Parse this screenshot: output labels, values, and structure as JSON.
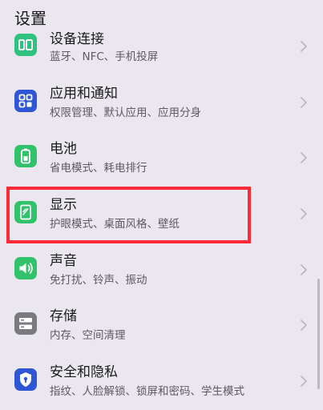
{
  "header": {
    "title": "设置"
  },
  "items": [
    {
      "title": "设备连接",
      "sub": "蓝牙、NFC、手机投屏",
      "icon": "device-connection-icon",
      "color": "#2ec27e"
    },
    {
      "title": "应用和通知",
      "sub": "权限管理、默认应用、应用分身",
      "icon": "apps-icon",
      "color": "#2f56d4"
    },
    {
      "title": "电池",
      "sub": "省电模式、耗电排行",
      "icon": "battery-icon",
      "color": "#33c26c"
    },
    {
      "title": "显示",
      "sub": "护眼模式、桌面风格、壁纸",
      "icon": "display-icon",
      "color": "#33c26c"
    },
    {
      "title": "声音",
      "sub": "免打扰、铃声、振动",
      "icon": "sound-icon",
      "color": "#33c26c"
    },
    {
      "title": "存储",
      "sub": "内存、空间清理",
      "icon": "storage-icon",
      "color": "#7a7a80"
    },
    {
      "title": "安全和隐私",
      "sub": "指纹、人脸解锁、锁屏和密码、学生模式",
      "icon": "security-icon",
      "color": "#2f56d4"
    }
  ],
  "colors": {
    "highlight": "#ff2a38",
    "background": "#ebe7ef"
  }
}
